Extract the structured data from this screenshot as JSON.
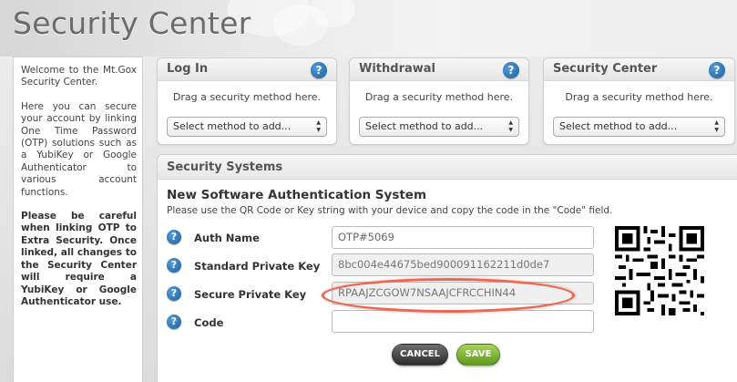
{
  "page": {
    "title": "Security Center"
  },
  "sidebar": {
    "intro": "Welcome to the Mt.Gox Security Center.",
    "description": "Here you can secure your account by linking One Time Password (OTP) solutions such as a YubiKey or Google Authenticator to various account functions.",
    "warning": "Please be careful when linking OTP to Extra Security. Once linked, all changes to the Security Center will require a YubiKey or Google Authenticator use."
  },
  "panels": [
    {
      "title": "Log In",
      "drag_text": "Drag a security method here.",
      "select_value": "Select method to add..."
    },
    {
      "title": "Withdrawal",
      "drag_text": "Drag a security method here.",
      "select_value": "Select method to add..."
    },
    {
      "title": "Security Center",
      "drag_text": "Drag a security method here.",
      "select_value": "Select method to add..."
    }
  ],
  "systems": {
    "title": "Security Systems",
    "heading": "New Software Authentication System",
    "description": "Please use the QR Code or Key string with your device and copy the code in the \"Code\" field.",
    "fields": [
      {
        "label": "Auth Name",
        "value": "OTP#5069"
      },
      {
        "label": "Standard Private Key",
        "value": "8bc004e44675bed900091162211d0de7"
      },
      {
        "label": "Secure Private Key",
        "value": "RPAAJZCGOW7NSAAJCFRCCHIN44"
      },
      {
        "label": "Code",
        "value": ""
      }
    ],
    "cancel_label": "CANCEL",
    "save_label": "SAVE"
  },
  "icons": {
    "help": "help-question-icon",
    "dropdown": "dropdown-arrows-icon",
    "qr": "qr-code"
  },
  "colors": {
    "help_icon": "#2a74b8",
    "save_button": "#7fb22e",
    "cancel_button": "#3f3f3f",
    "highlight": "#e86a55"
  }
}
